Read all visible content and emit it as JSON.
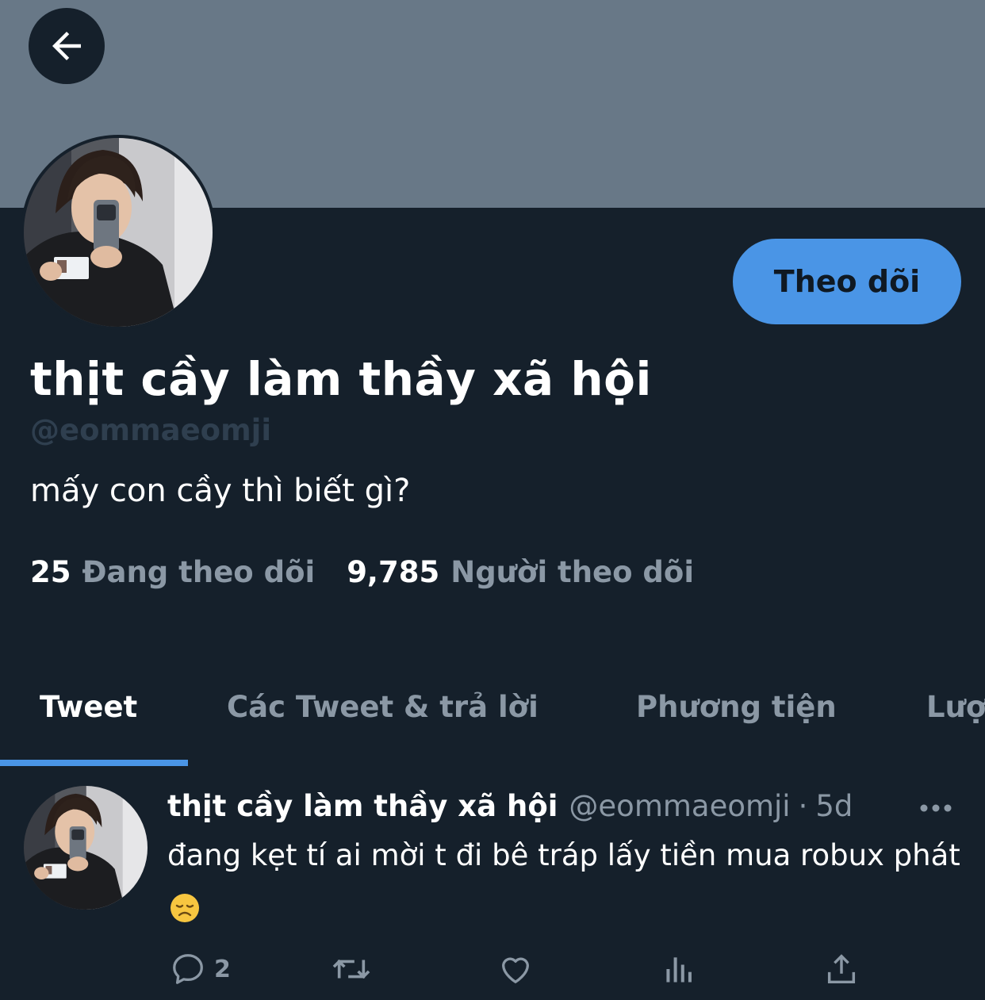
{
  "header": {
    "back_icon": "arrow-left-icon"
  },
  "profile": {
    "display_name": "thịt cầy làm thầy xã hội",
    "handle": "@eommaeomji",
    "bio": "mấy con cầy thì biết gì?",
    "follow_label": "Theo dõi",
    "following_count": "25",
    "following_label": "Đang theo dõi",
    "followers_count": "9,785",
    "followers_label": "Người theo dõi"
  },
  "tabs": [
    {
      "label": "Tweet",
      "active": true
    },
    {
      "label": "Các Tweet & trả lời",
      "active": false
    },
    {
      "label": "Phương tiện",
      "active": false
    },
    {
      "label": "Lượt thích",
      "active": false
    }
  ],
  "tweet": {
    "name": "thịt cầy làm thầy xã hội",
    "handle": "@eommaeomji",
    "separator": "·",
    "time": "5d",
    "text": "đang kẹt tí ai mời t đi bê tráp lấy tiền mua robux phát",
    "emoji": "disappointed-face-emoji",
    "reply_count": "2",
    "icons": [
      "reply-icon",
      "retweet-icon",
      "like-icon",
      "analytics-icon",
      "share-icon"
    ]
  },
  "colors": {
    "background": "#15202b",
    "banner": "#687887",
    "accent": "#4a95e6",
    "secondary_text": "#8b98a5",
    "handle_text": "#2f3f4f"
  }
}
